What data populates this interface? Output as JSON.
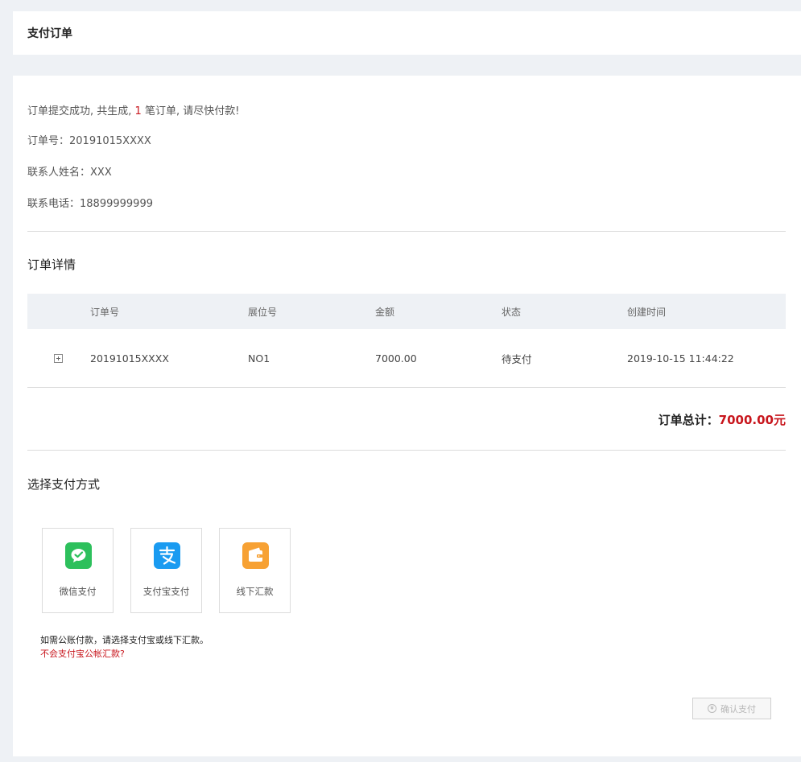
{
  "header": {
    "title": "支付订单"
  },
  "summary": {
    "msg_before": "订单提交成功, 共生成, ",
    "count": "1",
    "msg_after": " 笔订单, 请尽快付款!",
    "order_no_label": "订单号：",
    "order_no_value": "20191015XXXX",
    "contact_name_label": "联系人姓名：",
    "contact_name_value": "XXX",
    "phone_label": "联系电话：",
    "phone_value": "18899999999"
  },
  "details": {
    "title": "订单详情",
    "columns": [
      "订单号",
      "展位号",
      "金额",
      "状态",
      "创建时间"
    ],
    "rows": [
      {
        "order_no": "20191015XXXX",
        "booth_no": "NO1",
        "amount": "7000.00",
        "status": "待支付",
        "created_at": "2019-10-15 11:44:22"
      }
    ]
  },
  "total": {
    "label": "订单总计：",
    "amount": "7000.00元"
  },
  "payment": {
    "title": "选择支付方式",
    "methods": [
      {
        "label": "微信支付",
        "icon": "wechat-icon",
        "color": "#2dc05c"
      },
      {
        "label": "支付宝支付",
        "icon": "alipay-icon",
        "color": "#1a9bf1"
      },
      {
        "label": "线下汇款",
        "icon": "wallet-icon",
        "color": "#f7a133"
      }
    ],
    "note": "如需公账付款，请选择支付宝或线下汇款。",
    "help_link": "不会支付宝公帐汇款?",
    "confirm_label": "确认支付",
    "confirm_symbol": "¥"
  },
  "colors": {
    "accent": "#c8161d",
    "page_bg": "#eef1f5",
    "table_head_bg": "#eef1f5"
  }
}
